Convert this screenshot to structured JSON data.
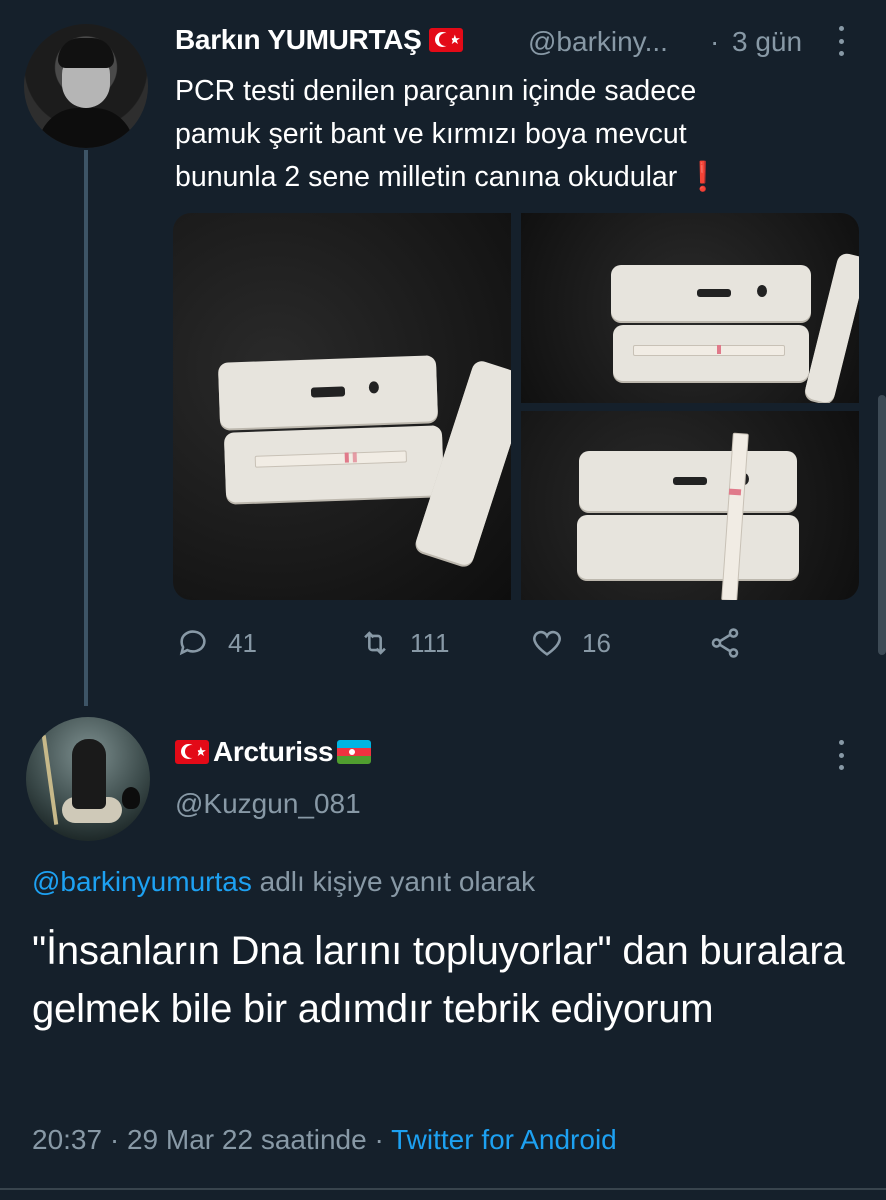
{
  "tweet1": {
    "author_name": "Barkın YUMURTAŞ",
    "author_flag": "turkey-flag",
    "handle": "@barkiny...",
    "separator": "·",
    "time": "3 gün",
    "text_line1": "PCR testi denilen parçanın içinde sadece",
    "text_line2": "pamuk şerit bant ve kırmızı boya mevcut",
    "text_line3": "bununla 2 sene milletin canına okudular",
    "text_emoji": "❗",
    "media_count": 3,
    "actions": {
      "replies": "41",
      "retweets": "111",
      "likes": "16"
    }
  },
  "tweet2": {
    "author_name": "Arcturiss",
    "author_flags": [
      "turkey-flag",
      "azerbaijan-flag"
    ],
    "handle": "@Kuzgun_081",
    "replying_mention": "@barkinyumurtas",
    "replying_suffix": " adlı kişiye yanıt olarak",
    "text": "\"İnsanların Dna larını topluyorlar\" dan buralara gelmek bile bir adımdır tebrik ediyorum",
    "time": "20:37",
    "sep1": " · ",
    "date": "29 Mar 22 saatinde",
    "sep2": " · ",
    "source": "Twitter for Android"
  },
  "colors": {
    "background": "#15202b",
    "muted": "#8899a6",
    "accent": "#1da1f2"
  }
}
